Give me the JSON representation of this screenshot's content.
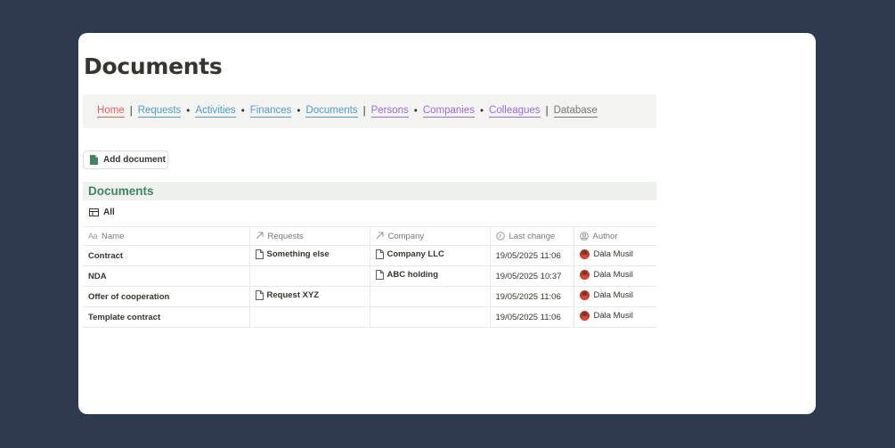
{
  "page": {
    "title": "Documents"
  },
  "nav": [
    {
      "label": "Home",
      "color": "#e16259",
      "sep_after": "|"
    },
    {
      "label": "Requests",
      "color": "#529cca",
      "sep_after": "•"
    },
    {
      "label": "Activities",
      "color": "#529cca",
      "sep_after": "•"
    },
    {
      "label": "Finances",
      "color": "#529cca",
      "sep_after": "•"
    },
    {
      "label": "Documents",
      "color": "#529cca",
      "sep_after": "|"
    },
    {
      "label": "Persons",
      "color": "#9a6dd7",
      "sep_after": "•"
    },
    {
      "label": "Companies",
      "color": "#9a6dd7",
      "sep_after": "•"
    },
    {
      "label": "Colleagues",
      "color": "#9a6dd7",
      "sep_after": "|"
    },
    {
      "label": "Database",
      "color": "#787774",
      "sep_after": ""
    }
  ],
  "add_button": {
    "label": "Add document",
    "icon": "document-icon",
    "icon_color": "#448361"
  },
  "database": {
    "title": "Documents",
    "view": {
      "label": "All",
      "icon": "table-icon"
    },
    "columns": [
      {
        "label": "Name",
        "prefix": "Aa"
      },
      {
        "label": "Requests",
        "icon": "relation-arrow-icon"
      },
      {
        "label": "Company",
        "icon": "relation-arrow-icon"
      },
      {
        "label": "Last change",
        "icon": "clock-icon"
      },
      {
        "label": "Author",
        "icon": "person-icon"
      }
    ],
    "rows": [
      {
        "name": "Contract",
        "requests": "Something else",
        "company": "Company LLC",
        "last_change": "19/05/2025 11:06",
        "author": "Dàla Musil"
      },
      {
        "name": "NDA",
        "requests": "",
        "company": "ABC holding",
        "last_change": "19/05/2025 10:37",
        "author": "Dàla Musil"
      },
      {
        "name": "Offer of cooperation",
        "requests": "Request XYZ",
        "company": "",
        "last_change": "19/05/2025 11:06",
        "author": "Dàla Musil"
      },
      {
        "name": "Template contract",
        "requests": "",
        "company": "",
        "last_change": "19/05/2025 11:06",
        "author": "Dàla Musil"
      }
    ]
  }
}
